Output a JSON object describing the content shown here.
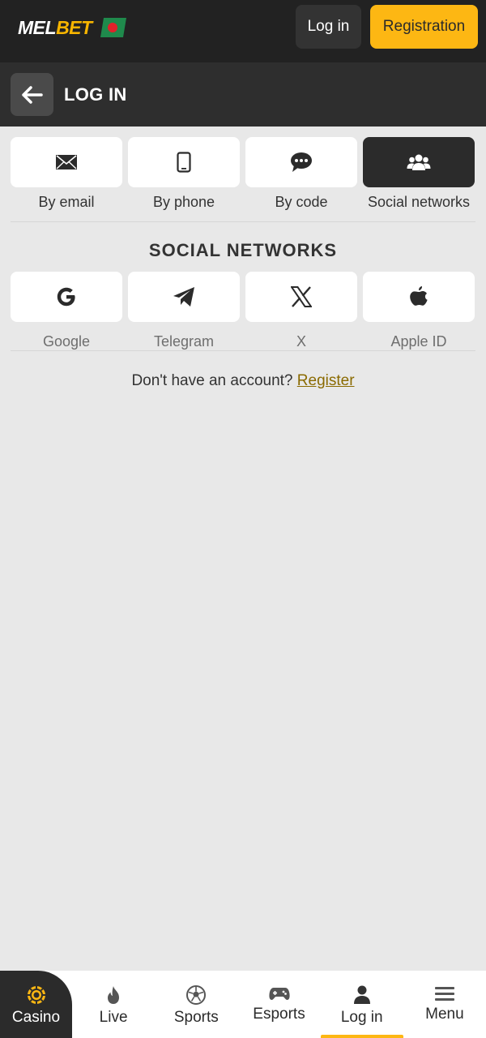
{
  "header": {
    "logo_part1": "MEL",
    "logo_part2": "BET",
    "login_label": "Log in",
    "registration_label": "Registration"
  },
  "subheader": {
    "title": "LOG IN"
  },
  "methods": [
    {
      "label": "By email",
      "icon": "envelope-icon",
      "active": false
    },
    {
      "label": "By phone",
      "icon": "phone-icon",
      "active": false
    },
    {
      "label": "By code",
      "icon": "chat-bubble-icon",
      "active": false
    },
    {
      "label": "Social networks",
      "icon": "users-icon",
      "active": true
    }
  ],
  "social_section": {
    "title": "SOCIAL NETWORKS",
    "items": [
      {
        "label": "Google",
        "icon": "google-icon"
      },
      {
        "label": "Telegram",
        "icon": "telegram-icon"
      },
      {
        "label": "X",
        "icon": "x-icon"
      },
      {
        "label": "Apple ID",
        "icon": "apple-icon"
      }
    ]
  },
  "account": {
    "prompt": "Don't have an account?",
    "register_link": "Register"
  },
  "bottom_nav": [
    {
      "label": "Casino",
      "icon": "casino-chip-icon"
    },
    {
      "label": "Live",
      "icon": "flame-icon"
    },
    {
      "label": "Sports",
      "icon": "soccer-ball-icon"
    },
    {
      "label": "Esports",
      "icon": "gamepad-icon"
    },
    {
      "label": "Log in",
      "icon": "user-icon"
    },
    {
      "label": "Menu",
      "icon": "hamburger-icon"
    }
  ],
  "colors": {
    "accent": "#fdb713",
    "header_bg": "#222222",
    "page_bg": "#e8e8e8"
  }
}
